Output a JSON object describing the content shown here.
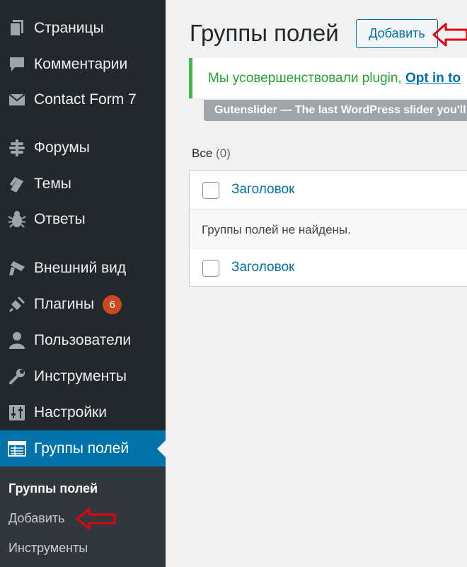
{
  "sidebar": {
    "items": [
      {
        "label": "Страницы",
        "icon": "pages-icon"
      },
      {
        "label": "Комментарии",
        "icon": "comments-icon"
      },
      {
        "label": "Contact Form 7",
        "icon": "mail-icon"
      },
      {
        "label": "Форумы",
        "icon": "forums-icon"
      },
      {
        "label": "Темы",
        "icon": "topics-icon"
      },
      {
        "label": "Ответы",
        "icon": "replies-icon"
      },
      {
        "label": "Внешний вид",
        "icon": "appearance-icon"
      },
      {
        "label": "Плагины",
        "icon": "plugins-icon",
        "badge": "6"
      },
      {
        "label": "Пользователи",
        "icon": "users-icon"
      },
      {
        "label": "Инструменты",
        "icon": "tools-icon"
      },
      {
        "label": "Настройки",
        "icon": "settings-icon"
      },
      {
        "label": "Группы полей",
        "icon": "field-groups-icon",
        "active": true
      }
    ],
    "submenu": [
      "Группы полей",
      "Добавить",
      "Инструменты"
    ]
  },
  "header": {
    "title": "Группы полей",
    "add_button": "Добавить"
  },
  "notice": {
    "text": "Мы усовершенствовали plugin, ",
    "link": "Opt in to"
  },
  "promo": {
    "text": "Gutenslider — The last WordPress slider you'll ever need"
  },
  "filter": {
    "label": "Все",
    "count": "(0)"
  },
  "table": {
    "column_title": "Заголовок",
    "empty_message": "Группы полей не найдены."
  },
  "colors": {
    "sidebar_bg": "#23282d",
    "active_bg": "#0073aa",
    "badge": "#ca4a1f",
    "notice_border": "#46b450",
    "annotation_arrow": "#e3000f"
  }
}
